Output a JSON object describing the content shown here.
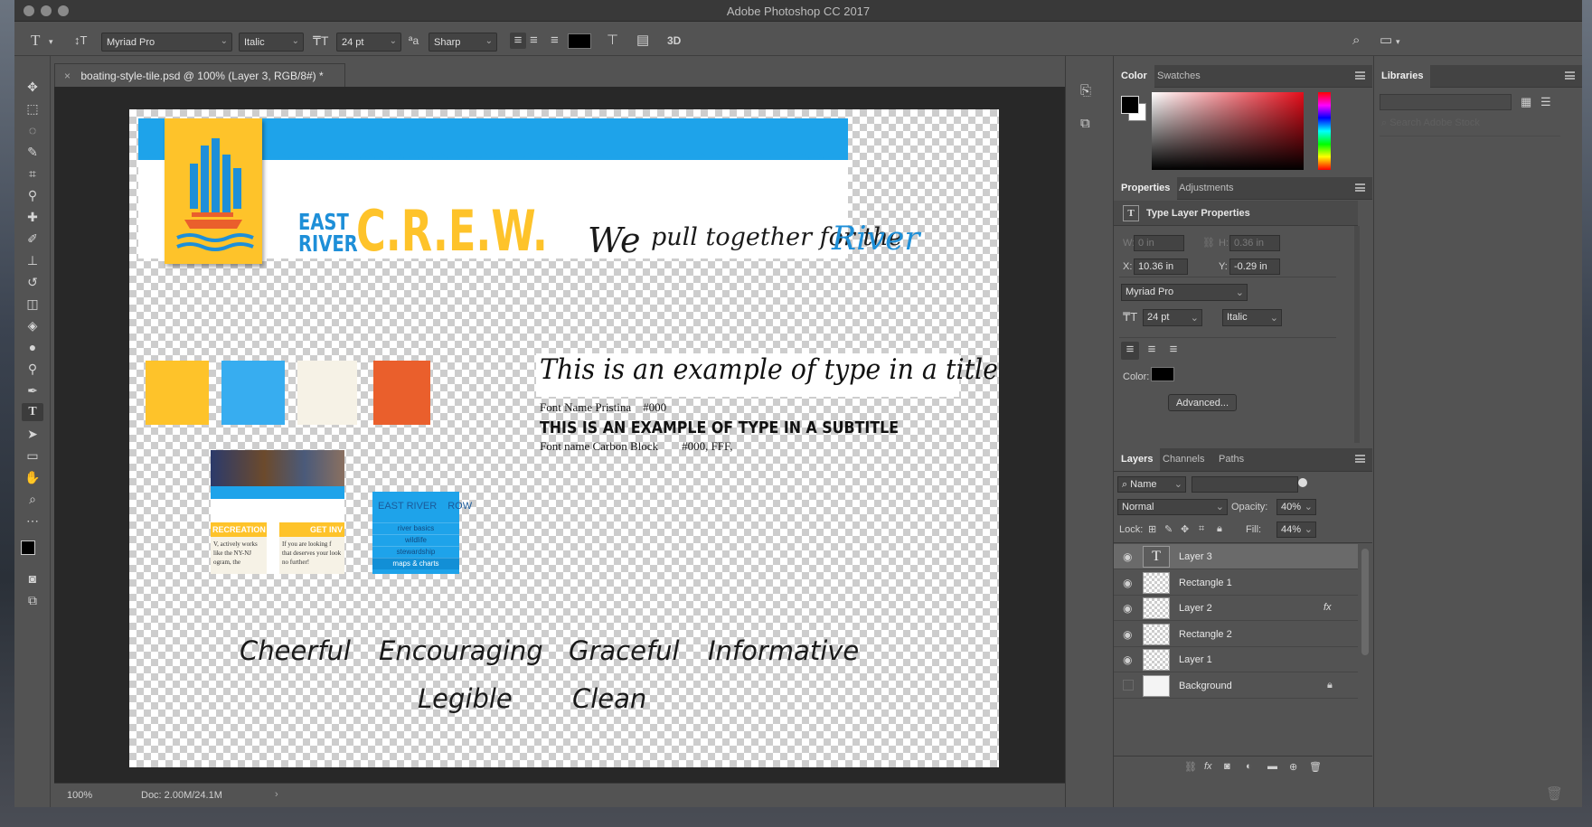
{
  "app": {
    "title": "Adobe Photoshop CC 2017"
  },
  "options_bar": {
    "font_family": "Myriad Pro",
    "font_style": "Italic",
    "font_size": "24 pt",
    "antialias": "Sharp",
    "three_d": "3D"
  },
  "document": {
    "tab_title": "boating-style-tile.psd @ 100% (Layer 3, RGB/8#) *",
    "zoom": "100%",
    "doc_size": "Doc: 2.00M/24.1M"
  },
  "canvas": {
    "logo_east": "EAST",
    "logo_river": "RIVER",
    "logo_crew": "C.R.E.W.",
    "tagline_1": "We",
    "tagline_2": "pull together for the",
    "tagline_3": "River",
    "title_example": "This is an example of type in a title",
    "title_font_note": "Font Name Pristina    #000",
    "subtitle_example": "THIS IS AN EXAMPLE OF TYPE IN A SUBTITLE",
    "subtitle_font_note": "Font name Carbon Block        #000, FFF,",
    "swatches": [
      "#fec32a",
      "#37adf0",
      "#f6f2e6",
      "#ea5f2c"
    ],
    "card_1": "RECREATION",
    "card_2": "GET INV",
    "card_text_1": "V, actively works like the NY-NJ ogram, the",
    "card_text_2": "If you are looking f that deserves your look no further!",
    "nav_brand": "EAST RIVER",
    "nav_row": "ROW",
    "nav_items": [
      "river basics",
      "wildlife",
      "stewardship",
      "maps & charts"
    ],
    "mood_words_row1": [
      "Cheerful",
      "Encouraging",
      "Graceful",
      "Informative"
    ],
    "mood_words_row2": [
      "Legible",
      "Clean"
    ]
  },
  "color_panel": {
    "tabs": [
      "Color",
      "Swatches"
    ]
  },
  "libraries_panel": {
    "title": "Libraries",
    "search_placeholder": "Search Adobe Stock"
  },
  "properties_panel": {
    "tabs": [
      "Properties",
      "Adjustments"
    ],
    "heading": "Type Layer Properties",
    "w_label": "W:",
    "w_value": "0 in",
    "h_label": "H:",
    "h_value": "0.36 in",
    "x_label": "X:",
    "x_value": "10.36 in",
    "y_label": "Y:",
    "y_value": "-0.29 in",
    "font": "Myriad Pro",
    "size": "24 pt",
    "style": "Italic",
    "color_label": "Color:",
    "advanced_button": "Advanced..."
  },
  "layers_panel": {
    "tabs": [
      "Layers",
      "Channels",
      "Paths"
    ],
    "filter": "Name",
    "blend_mode": "Normal",
    "opacity_label": "Opacity:",
    "opacity_value": "40%",
    "lock_label": "Lock:",
    "fill_label": "Fill:",
    "fill_value": "44%",
    "layers": [
      {
        "name": "Layer 3",
        "selected": true,
        "visible": true
      },
      {
        "name": "Rectangle 1",
        "selected": false,
        "visible": true
      },
      {
        "name": "Layer 2",
        "selected": false,
        "visible": true,
        "fx": "fx"
      },
      {
        "name": "Rectangle 2",
        "selected": false,
        "visible": true
      },
      {
        "name": "Layer 1",
        "selected": false,
        "visible": true
      },
      {
        "name": "Background",
        "selected": false,
        "visible": false,
        "locked": true
      }
    ]
  },
  "colors": {
    "ps_dark": "#535353",
    "brand_yellow": "#fec32a",
    "brand_blue": "#1ea3ea"
  }
}
